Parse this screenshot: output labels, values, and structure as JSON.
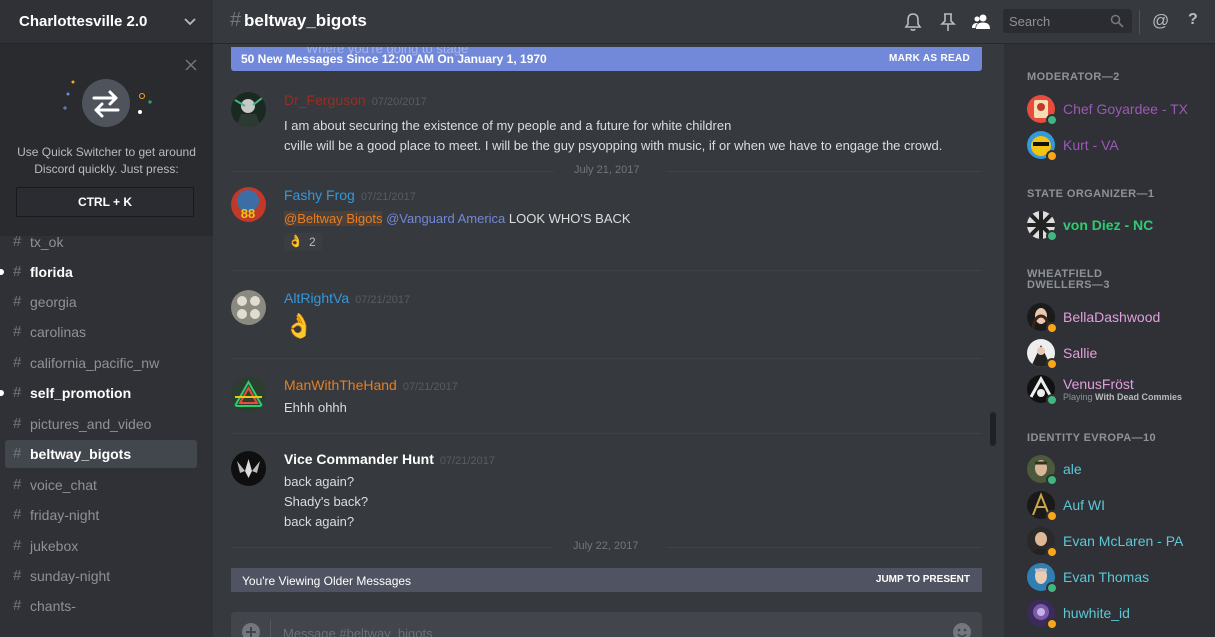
{
  "server": {
    "name": "Charlottesville 2.0"
  },
  "quick_switcher": {
    "text_line1": "Use Quick Switcher to get around",
    "text_line2": "Discord quickly. Just press:",
    "shortcut": "CTRL + K"
  },
  "channels": [
    {
      "name": "tx_ok",
      "state": "normal"
    },
    {
      "name": "florida",
      "state": "unread"
    },
    {
      "name": "georgia",
      "state": "normal"
    },
    {
      "name": "carolinas",
      "state": "normal"
    },
    {
      "name": "california_pacific_nw",
      "state": "normal"
    },
    {
      "name": "self_promotion",
      "state": "unread"
    },
    {
      "name": "pictures_and_video",
      "state": "normal"
    },
    {
      "name": "beltway_bigots",
      "state": "active"
    },
    {
      "name": "voice_chat",
      "state": "normal"
    },
    {
      "name": "friday-night",
      "state": "normal"
    },
    {
      "name": "jukebox",
      "state": "normal"
    },
    {
      "name": "sunday-night",
      "state": "normal"
    },
    {
      "name": "chants-",
      "state": "normal"
    }
  ],
  "topbar": {
    "channel_name": "beltway_bigots",
    "search_placeholder": "Search",
    "at_label": "@",
    "help_label": "?"
  },
  "chat": {
    "new_messages_bar": {
      "text": "50 New Messages Since 12:00 AM On January 1, 1970",
      "action": "MARK AS READ",
      "ghost_text": "Where you're going to stage"
    },
    "messages": [
      {
        "author": "Dr_Ferguson",
        "author_color": "#992d22",
        "timestamp": "07/20/2017",
        "lines": [
          "I am about securing the existence of my people and a future for white children",
          "cville will be a good place to meet. I will be the guy psyopping with music,  if or when we have to engage the crowd."
        ]
      },
      {
        "author": "Fashy Frog",
        "author_color": "#3498db",
        "timestamp": "07/21/2017",
        "mention1": "@Beltway Bigots",
        "mention2": "@Vanguard America",
        "text": "LOOK WHO'S BACK",
        "reaction": {
          "emoji": "ok-hand",
          "count": "2"
        }
      },
      {
        "author": "AltRightVa",
        "author_color": "#3498db",
        "timestamp": "07/21/2017",
        "emoji": "ok-hand"
      },
      {
        "author": "ManWithTheHand",
        "author_color": "#e67e22",
        "timestamp": "07/21/2017",
        "lines": [
          "Ehhh ohhh"
        ]
      },
      {
        "author": "Vice Commander Hunt",
        "author_color": "#ffffff",
        "timestamp": "07/21/2017",
        "lines": [
          "back again?",
          "Shady's back?",
          "back again?"
        ]
      }
    ],
    "date_dividers": [
      "July 21, 2017",
      "July 22, 2017"
    ],
    "older_bar": {
      "text": "You're Viewing Older Messages",
      "action": "JUMP TO PRESENT"
    },
    "composer_placeholder": "Message #beltway_bigots"
  },
  "members": {
    "roles": [
      {
        "name": "MODERATOR—2",
        "members": [
          {
            "name": "Chef Goyardee - TX",
            "color": "#9b59b6",
            "status": "online"
          },
          {
            "name": "Kurt - VA",
            "color": "#9b59b6",
            "status": "idle"
          }
        ]
      },
      {
        "name": "STATE ORGANIZER—1",
        "members": [
          {
            "name": "von Diez - NC",
            "color": "#2ecc71",
            "status": "online"
          }
        ]
      },
      {
        "name": "WHEATFIELD",
        "name2": "DWELLERS—3",
        "members": [
          {
            "name": "BellaDashwood",
            "color": "#e39fdc",
            "status": "idle"
          },
          {
            "name": "Sallie",
            "color": "#e39fdc",
            "status": "idle"
          },
          {
            "name": "VenusFröst",
            "color": "#e39fdc",
            "status": "online",
            "activity_prefix": "Playing",
            "activity": "With Dead Commies"
          }
        ]
      },
      {
        "name": "IDENTITY EVROPA—10",
        "members": [
          {
            "name": "ale",
            "color": "#5cc8d6",
            "status": "online"
          },
          {
            "name": "Auf WI",
            "color": "#5cc8d6",
            "status": "idle"
          },
          {
            "name": "Evan McLaren - PA",
            "color": "#5cc8d6",
            "status": "idle"
          },
          {
            "name": "Evan Thomas",
            "color": "#5cc8d6",
            "status": "online"
          },
          {
            "name": "huwhite_id",
            "color": "#5cc8d6",
            "status": "idle"
          }
        ]
      }
    ]
  },
  "colors": {
    "online": "#43b581",
    "idle": "#faa61a",
    "accent": "#7289da"
  }
}
